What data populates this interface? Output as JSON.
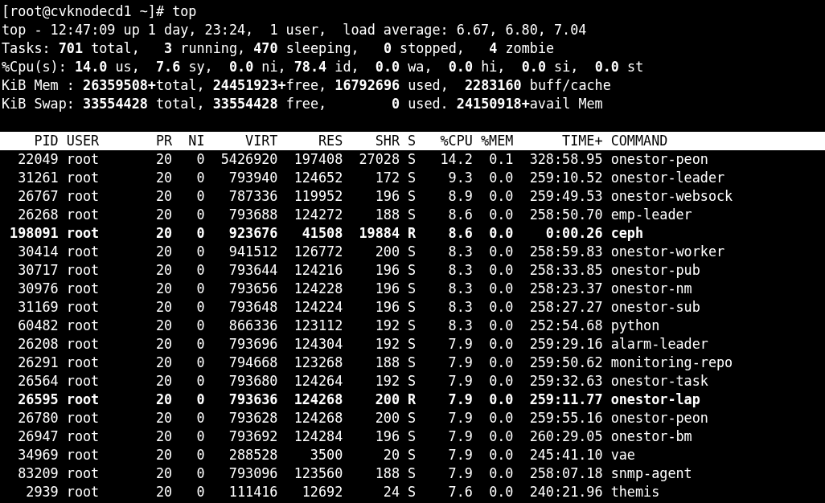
{
  "prompt": "[root@cvknodecd1 ~]# top",
  "summary_lines": [
    "top - 12:47:09 up 1 day, 23:24,  1 user,  load average: 6.67, 6.80, 7.04",
    "Tasks: **701** total,   **3** running, **470** sleeping,   **0** stopped,   **4** zombie",
    "%Cpu(s): **14.0** us,  **7.6** sy,  **0.0** ni, **78.4** id,  **0.0** wa,  **0.0** hi,  **0.0** si,  **0.0** st",
    "KiB Mem : **26359508+**total, **24451923+**free, **16792696** used,  **2283160** buff/cache",
    "KiB Swap: **33554428** total, **33554428** free,        **0** used. **24150918+**avail Mem"
  ],
  "table": {
    "columns": [
      "PID",
      "USER",
      "PR",
      "NI",
      "VIRT",
      "RES",
      "SHR",
      "S",
      "%CPU",
      "%MEM",
      "TIME+",
      "COMMAND"
    ],
    "rows": [
      {
        "cells": [
          "22049",
          "root",
          "20",
          "0",
          "5426920",
          "197408",
          "27028",
          "S",
          "14.2",
          "0.1",
          "328:58.95",
          "onestor-peon"
        ],
        "highlighted": false
      },
      {
        "cells": [
          "31261",
          "root",
          "20",
          "0",
          "793940",
          "124652",
          "172",
          "S",
          "9.3",
          "0.0",
          "259:10.52",
          "onestor-leader"
        ],
        "highlighted": false
      },
      {
        "cells": [
          "26767",
          "root",
          "20",
          "0",
          "787336",
          "119952",
          "196",
          "S",
          "8.9",
          "0.0",
          "259:49.53",
          "onestor-websock"
        ],
        "highlighted": false
      },
      {
        "cells": [
          "26268",
          "root",
          "20",
          "0",
          "793688",
          "124272",
          "188",
          "S",
          "8.6",
          "0.0",
          "258:50.70",
          "emp-leader"
        ],
        "highlighted": false
      },
      {
        "cells": [
          "198091",
          "root",
          "20",
          "0",
          "923676",
          "41508",
          "19884",
          "R",
          "8.6",
          "0.0",
          "0:00.26",
          "ceph"
        ],
        "highlighted": true
      },
      {
        "cells": [
          "30414",
          "root",
          "20",
          "0",
          "941512",
          "126772",
          "200",
          "S",
          "8.3",
          "0.0",
          "258:59.83",
          "onestor-worker"
        ],
        "highlighted": false
      },
      {
        "cells": [
          "30717",
          "root",
          "20",
          "0",
          "793644",
          "124216",
          "196",
          "S",
          "8.3",
          "0.0",
          "258:33.85",
          "onestor-pub"
        ],
        "highlighted": false
      },
      {
        "cells": [
          "30976",
          "root",
          "20",
          "0",
          "793656",
          "124228",
          "196",
          "S",
          "8.3",
          "0.0",
          "258:23.37",
          "onestor-nm"
        ],
        "highlighted": false
      },
      {
        "cells": [
          "31169",
          "root",
          "20",
          "0",
          "793648",
          "124224",
          "196",
          "S",
          "8.3",
          "0.0",
          "258:27.27",
          "onestor-sub"
        ],
        "highlighted": false
      },
      {
        "cells": [
          "60482",
          "root",
          "20",
          "0",
          "866336",
          "123112",
          "192",
          "S",
          "8.3",
          "0.0",
          "252:54.68",
          "python"
        ],
        "highlighted": false
      },
      {
        "cells": [
          "26208",
          "root",
          "20",
          "0",
          "793696",
          "124304",
          "192",
          "S",
          "7.9",
          "0.0",
          "259:29.16",
          "alarm-leader"
        ],
        "highlighted": false
      },
      {
        "cells": [
          "26291",
          "root",
          "20",
          "0",
          "794668",
          "123268",
          "188",
          "S",
          "7.9",
          "0.0",
          "259:50.62",
          "monitoring-repo"
        ],
        "highlighted": false
      },
      {
        "cells": [
          "26564",
          "root",
          "20",
          "0",
          "793680",
          "124264",
          "192",
          "S",
          "7.9",
          "0.0",
          "259:32.63",
          "onestor-task"
        ],
        "highlighted": false
      },
      {
        "cells": [
          "26595",
          "root",
          "20",
          "0",
          "793636",
          "124268",
          "200",
          "R",
          "7.9",
          "0.0",
          "259:11.77",
          "onestor-lap"
        ],
        "highlighted": true
      },
      {
        "cells": [
          "26780",
          "root",
          "20",
          "0",
          "793628",
          "124268",
          "200",
          "S",
          "7.9",
          "0.0",
          "259:55.16",
          "onestor-peon"
        ],
        "highlighted": false
      },
      {
        "cells": [
          "26947",
          "root",
          "20",
          "0",
          "793692",
          "124284",
          "196",
          "S",
          "7.9",
          "0.0",
          "260:29.05",
          "onestor-bm"
        ],
        "highlighted": false
      },
      {
        "cells": [
          "34969",
          "root",
          "20",
          "0",
          "288528",
          "3500",
          "20",
          "S",
          "7.9",
          "0.0",
          "245:41.10",
          "vae"
        ],
        "highlighted": false
      },
      {
        "cells": [
          "83209",
          "root",
          "20",
          "0",
          "793096",
          "123560",
          "188",
          "S",
          "7.9",
          "0.0",
          "258:07.18",
          "snmp-agent"
        ],
        "highlighted": false
      },
      {
        "cells": [
          "2939",
          "root",
          "20",
          "0",
          "111416",
          "12692",
          "24",
          "S",
          "7.6",
          "0.0",
          "240:21.96",
          "themis"
        ],
        "highlighted": false
      }
    ]
  }
}
